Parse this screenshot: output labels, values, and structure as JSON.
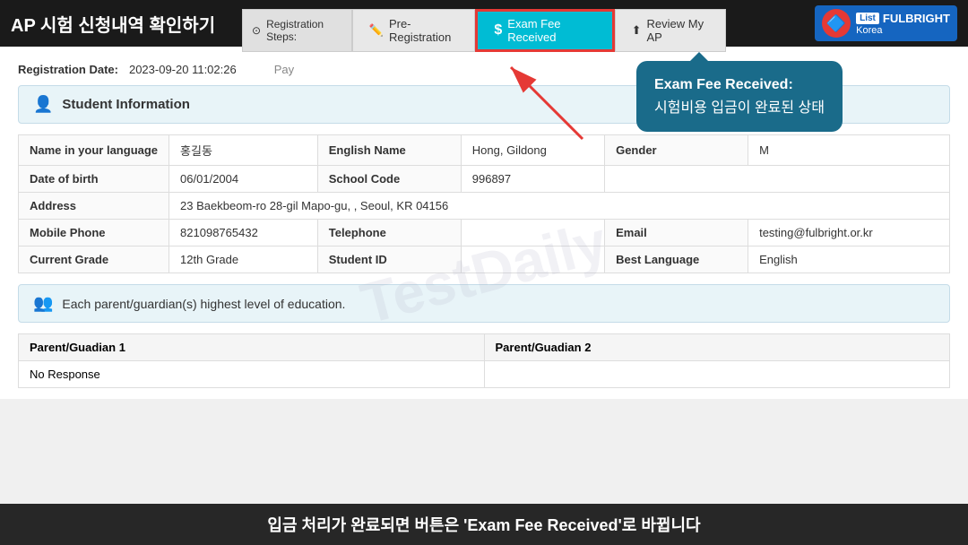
{
  "topBar": {
    "title": "AP 시험 신청내역 확인하기"
  },
  "navTabs": [
    {
      "id": "registration-steps",
      "label": "Registration Steps:",
      "icon": "⊙",
      "active": false
    },
    {
      "id": "pre-registration",
      "label": "Pre-Registration",
      "icon": "✏️",
      "active": false
    },
    {
      "id": "exam-fee-received",
      "label": "Exam Fee Received",
      "icon": "$",
      "active": true
    },
    {
      "id": "review-my-ap",
      "label": "Review My AP",
      "icon": "⬆",
      "active": false
    }
  ],
  "logo": {
    "badge": "List",
    "name": "FULBRIGHT",
    "sub": "Korea"
  },
  "form": {
    "regDateLabel": "Registration Date:",
    "regDateValue": "2023-09-20 11:02:26",
    "payLabel": "Pay"
  },
  "studentInfoSection": {
    "icon": "👤",
    "title": "Student Information"
  },
  "studentFields": [
    {
      "label": "Name in your language",
      "value": "홍길동",
      "col2label": "English Name",
      "col2value": "Hong, Gildong",
      "col3label": "Gender",
      "col3value": "M"
    },
    {
      "label": "Date of birth",
      "value": "06/01/2004",
      "col2label": "School Code",
      "col2value": "996897",
      "col3label": "",
      "col3value": ""
    },
    {
      "label": "Address",
      "value": "23 Baekbeom-ro 28-gil Mapo-gu, , Seoul, KR 04156",
      "col2label": "",
      "col2value": "",
      "col3label": "",
      "col3value": ""
    },
    {
      "label": "Mobile Phone",
      "value": "821098765432",
      "col2label": "Telephone",
      "col2value": "",
      "col3label": "Email",
      "col3value": "testing@fulbright.or.kr"
    },
    {
      "label": "Current Grade",
      "value": "12th Grade",
      "col2label": "Student ID",
      "col2value": "",
      "col3label": "Best Language",
      "col3value": "English"
    }
  ],
  "guardianSection": {
    "icon": "👥",
    "text": "Each parent/guardian(s) highest level of education."
  },
  "guardianTable": {
    "col1": "Parent/Guadian 1",
    "col2": "Parent/Guadian 2",
    "row1col1": "No Response",
    "row1col2": ""
  },
  "tooltip": {
    "line1": "Exam Fee Received:",
    "line2": "시험비용 입금이 완료된 상태"
  },
  "bottomBanner": {
    "text": "입금 처리가 완료되면 버튼은 'Exam Fee Received'로 바뀝니다"
  },
  "watermark": "TestDaily"
}
